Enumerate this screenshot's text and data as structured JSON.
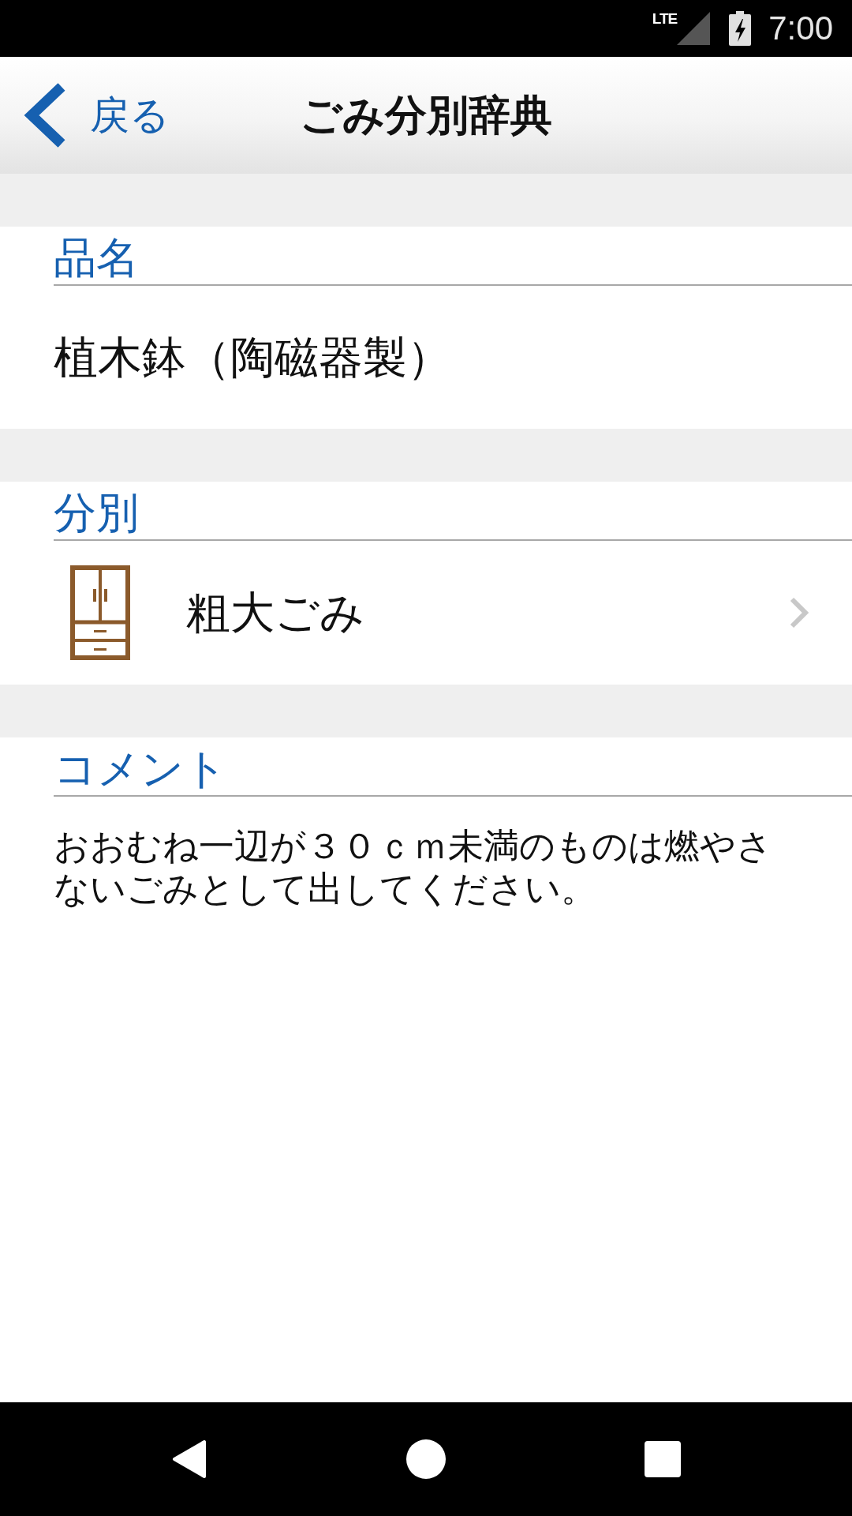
{
  "status_bar": {
    "network": "LTE",
    "charging": true,
    "time": "7:00"
  },
  "header": {
    "back_label": "戻る",
    "title": "ごみ分別辞典"
  },
  "sections": [
    {
      "kind": "text",
      "label": "品名",
      "value": "植木鉢（陶磁器製）"
    },
    {
      "kind": "link",
      "label": "分別",
      "value": "粗大ごみ"
    },
    {
      "kind": "note",
      "label": "コメント",
      "value": "おおむね一辺が３０ｃｍ未満のものは燃やさないごみとして出してください。"
    }
  ]
}
